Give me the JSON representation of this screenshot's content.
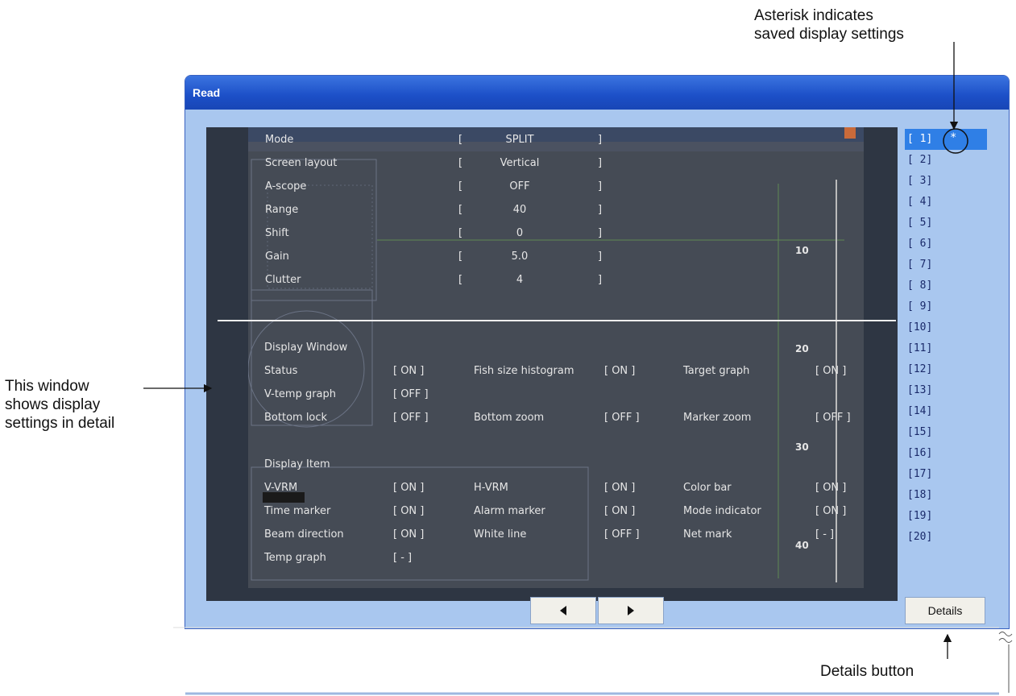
{
  "annotations": {
    "asterisk_line1": "Asterisk indicates",
    "asterisk_line2": "saved display settings",
    "window_line1": "This window",
    "window_line2": "shows display",
    "window_line3": "settings in detail",
    "details_button_label": "Details button"
  },
  "window": {
    "title": "Read"
  },
  "settings": [
    {
      "label": "Mode",
      "value": "SPLIT"
    },
    {
      "label": "Screen layout",
      "value": "Vertical"
    },
    {
      "label": "A-scope",
      "value": "OFF"
    },
    {
      "label": "Range",
      "value": "40"
    },
    {
      "label": "Shift",
      "value": "0"
    },
    {
      "label": "Gain",
      "value": "5.0"
    },
    {
      "label": "Clutter",
      "value": "4"
    }
  ],
  "display_window": {
    "heading": "Display Window",
    "rows": [
      [
        {
          "label": "Status",
          "value": "[ ON  ]"
        },
        {
          "label": "Fish size histogram",
          "value": "[ ON  ]"
        },
        {
          "label": "Target graph",
          "value": "[ ON  ]"
        }
      ],
      [
        {
          "label": "V-temp graph",
          "value": "[ OFF ]"
        }
      ],
      [
        {
          "label": "Bottom lock",
          "value": "[ OFF ]"
        },
        {
          "label": "Bottom zoom",
          "value": "[ OFF ]"
        },
        {
          "label": "Marker zoom",
          "value": "[ OFF ]"
        }
      ]
    ]
  },
  "display_item": {
    "heading": "Display Item",
    "rows": [
      [
        {
          "label": "V-VRM",
          "value": "[ ON  ]"
        },
        {
          "label": "H-VRM",
          "value": "[ ON  ]"
        },
        {
          "label": "Color bar",
          "value": "[ ON  ]"
        }
      ],
      [
        {
          "label": "Time marker",
          "value": "[ ON  ]"
        },
        {
          "label": "Alarm marker",
          "value": "[ ON  ]"
        },
        {
          "label": "Mode indicator",
          "value": "[ ON  ]"
        }
      ],
      [
        {
          "label": "Beam direction",
          "value": "[ ON  ]"
        },
        {
          "label": "White line",
          "value": "[ OFF ]"
        },
        {
          "label": "Net mark",
          "value": "[  -  ]"
        }
      ],
      [
        {
          "label": "Temp graph",
          "value": "[  -  ]"
        }
      ]
    ]
  },
  "depth_scale": [
    "10",
    "20",
    "30",
    "40"
  ],
  "slots": [
    "[ 1]",
    "[ 2]",
    "[ 3]",
    "[ 4]",
    "[ 5]",
    "[ 6]",
    "[ 7]",
    "[ 8]",
    "[ 9]",
    "[10]",
    "[11]",
    "[12]",
    "[13]",
    "[14]",
    "[15]",
    "[16]",
    "[17]",
    "[18]",
    "[19]",
    "[20]"
  ],
  "saved_marker": "*",
  "buttons": {
    "details": "Details"
  },
  "icons": {
    "prev": "triangle-left-icon",
    "next": "triangle-right-icon"
  },
  "colors": {
    "title_bar": "#1c4fc7",
    "window_bg": "#a9c7ef",
    "selected_slot": "#2f7fe6",
    "panel_bg": "#2e3643"
  }
}
